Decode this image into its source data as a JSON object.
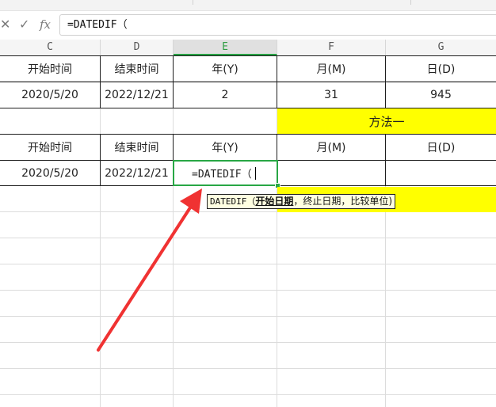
{
  "formula_bar": {
    "cancel_icon": "✕",
    "confirm_icon": "✓",
    "fx_label": "fx",
    "value": "=DATEDIF（"
  },
  "columns": [
    "C",
    "D",
    "E",
    "F",
    "G"
  ],
  "active_column": "E",
  "table1": {
    "headers": [
      "开始时间",
      "结束时间",
      "年(Y)",
      "月(M)",
      "日(D)"
    ],
    "values": [
      "2020/5/20",
      "2022/12/21",
      "2",
      "31",
      "945"
    ]
  },
  "method_label": "方法一",
  "table2": {
    "headers": [
      "开始时间",
      "结束时间",
      "年(Y)",
      "月(M)",
      "日(D)"
    ],
    "values": [
      "2020/5/20",
      "2022/12/21",
      "=DATEDIF（",
      "",
      ""
    ]
  },
  "tooltip": {
    "fn": "DATEDIF（",
    "arg1": "开始日期",
    "rest": "，终止日期，比较单位)"
  },
  "colors": {
    "highlight": "#ffff00",
    "active_green": "#28a745",
    "arrow_red": "#f03232"
  }
}
